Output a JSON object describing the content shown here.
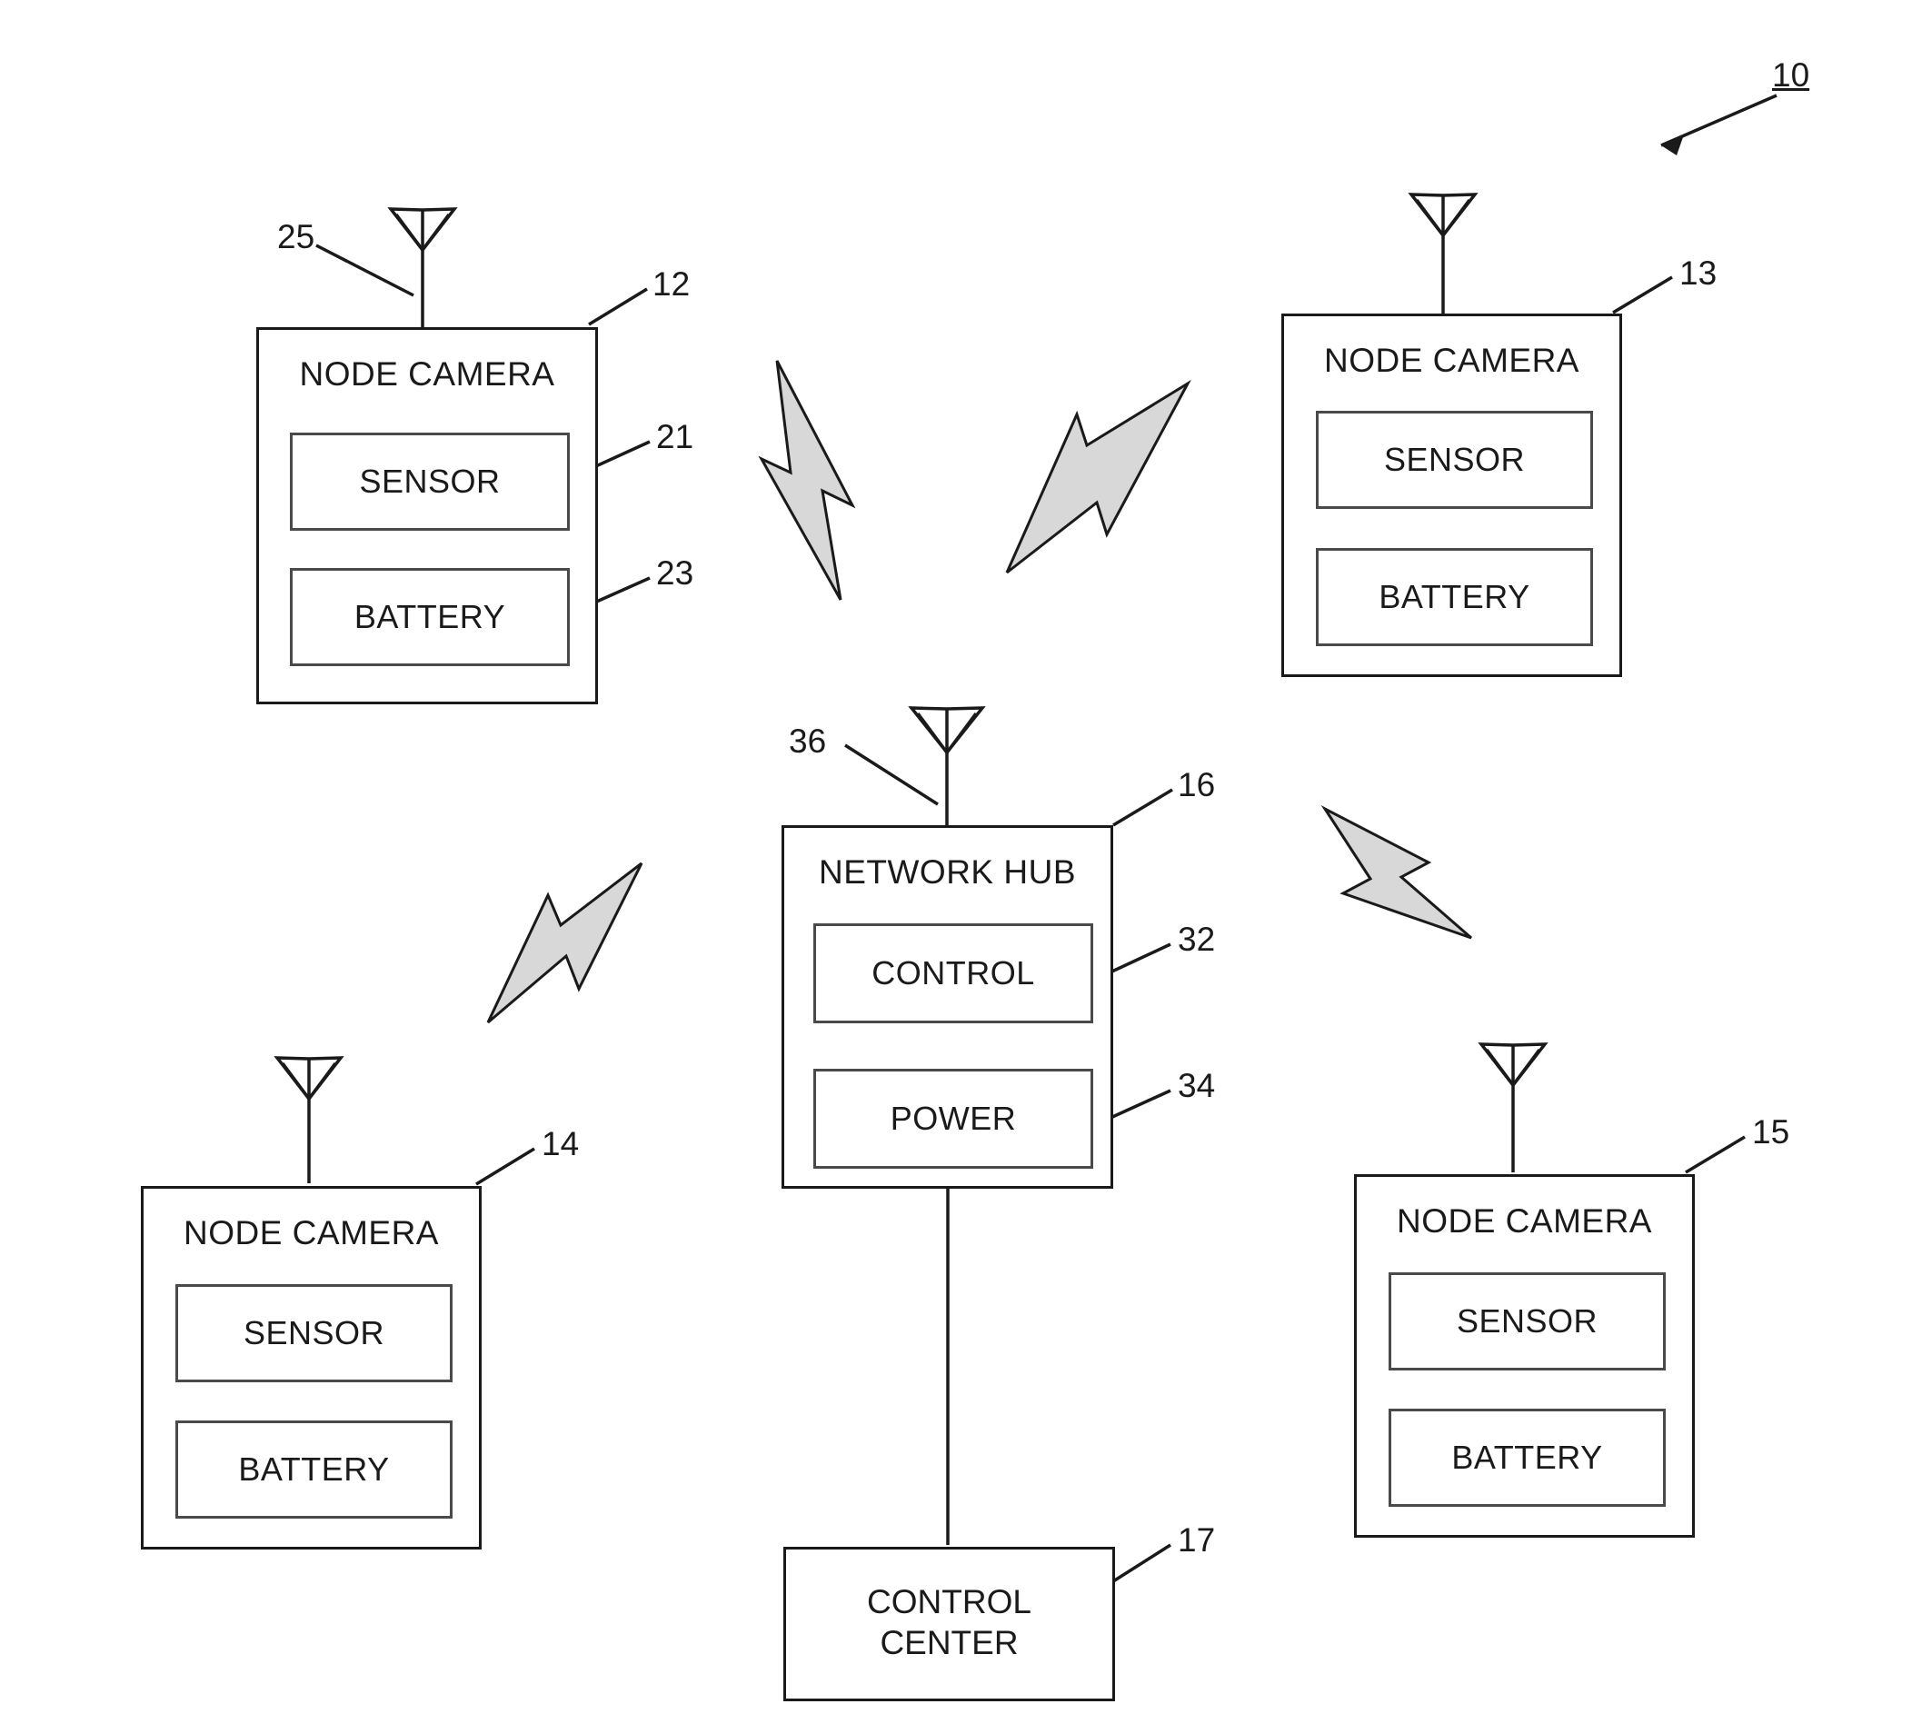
{
  "figure": {
    "ref_label": "10",
    "nodes": [
      {
        "id": "node-camera-12",
        "title": "NODE CAMERA",
        "ref": "12",
        "antenna_ref": "25",
        "components": [
          {
            "label": "SENSOR",
            "ref": "21"
          },
          {
            "label": "BATTERY",
            "ref": "23"
          }
        ]
      },
      {
        "id": "node-camera-13",
        "title": "NODE CAMERA",
        "ref": "13",
        "components": [
          {
            "label": "SENSOR",
            "ref": ""
          },
          {
            "label": "BATTERY",
            "ref": ""
          }
        ]
      },
      {
        "id": "node-camera-14",
        "title": "NODE CAMERA",
        "ref": "14",
        "components": [
          {
            "label": "SENSOR",
            "ref": ""
          },
          {
            "label": "BATTERY",
            "ref": ""
          }
        ]
      },
      {
        "id": "node-camera-15",
        "title": "NODE CAMERA",
        "ref": "15",
        "components": [
          {
            "label": "SENSOR",
            "ref": ""
          },
          {
            "label": "BATTERY",
            "ref": ""
          }
        ]
      },
      {
        "id": "network-hub-16",
        "title": "NETWORK HUB",
        "ref": "16",
        "antenna_ref": "36",
        "components": [
          {
            "label": "CONTROL",
            "ref": "32"
          },
          {
            "label": "POWER",
            "ref": "34"
          }
        ]
      },
      {
        "id": "control-center-17",
        "title_line1": "CONTROL",
        "title_line2": "CENTER",
        "ref": "17"
      }
    ]
  }
}
